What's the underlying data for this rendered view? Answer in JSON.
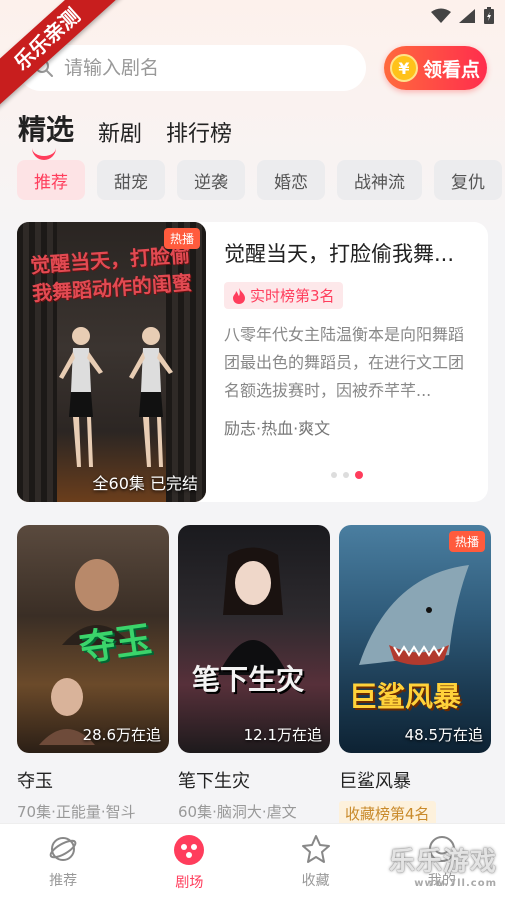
{
  "status_bar": {
    "icons": [
      "wifi-icon",
      "signal-icon",
      "battery-icon"
    ]
  },
  "ribbon": {
    "text": "乐乐亲测"
  },
  "search": {
    "placeholder": "请输入剧名"
  },
  "reward_button": {
    "coin_symbol": "¥",
    "label": "领看点"
  },
  "top_tabs": [
    {
      "label": "精选",
      "active": true
    },
    {
      "label": "新剧",
      "active": false
    },
    {
      "label": "排行榜",
      "active": false
    }
  ],
  "categories": [
    "推荐",
    "甜宠",
    "逆袭",
    "婚恋",
    "战神流",
    "复仇"
  ],
  "featured": {
    "poster_art_text": "觉醒当天，打脸偷我舞蹈动作的闺蜜",
    "hot_tag": "热播",
    "caption": "全60集  已完结",
    "title": "觉醒当天，打脸偷我舞...",
    "rank": "实时榜第3名",
    "description": "八零年代女主陆温衡本是向阳舞蹈团最出色的舞蹈员，在进行文工团名额选拔赛时，因被乔芊芊...",
    "tags": "励志·热血·爽文",
    "carousel_active_index": 2,
    "carousel_count": 3
  },
  "dramas": [
    {
      "name": "夺玉",
      "art_text": "夺玉",
      "count": "28.6万在追",
      "meta": "70集·正能量·智斗",
      "hot": false
    },
    {
      "name": "笔下生灾",
      "art_text": "笔下生灾",
      "count": "12.1万在追",
      "meta": "60集·脑洞大·虐文",
      "hot": false
    },
    {
      "name": "巨鲨风暴",
      "art_text": "巨鲨风暴",
      "count": "48.5万在追",
      "meta": "收藏榜第4名",
      "hot": true,
      "hot_tag": "热播"
    }
  ],
  "bottom_nav": [
    {
      "label": "推荐",
      "icon": "planet-icon",
      "active": false
    },
    {
      "label": "剧场",
      "icon": "theater-icon",
      "active": true
    },
    {
      "label": "收藏",
      "icon": "star-icon",
      "active": false
    },
    {
      "label": "我的",
      "icon": "profile-icon",
      "active": false
    }
  ],
  "watermark": {
    "text": "乐乐游戏",
    "sub": "www.7ll.com"
  },
  "colors": {
    "accent": "#ff3d5c",
    "coin": "#ffc21a",
    "hot": "#ff5b3d"
  }
}
